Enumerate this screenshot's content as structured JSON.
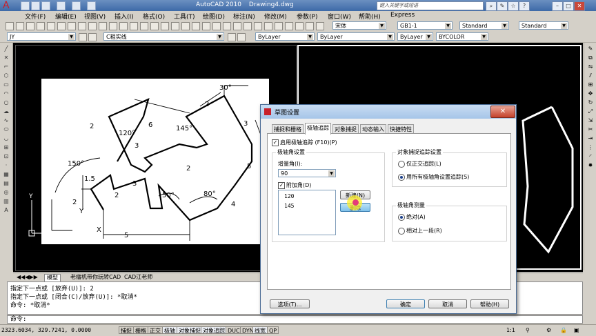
{
  "app": {
    "title_app": "AutoCAD 2010",
    "title_doc": "Drawing4.dwg",
    "search_placeholder": "键入关键字或短语",
    "logo_glyph": "A"
  },
  "menu": [
    "文件(F)",
    "编辑(E)",
    "视图(V)",
    "插入(I)",
    "格式(O)",
    "工具(T)",
    "绘图(D)",
    "标注(N)",
    "修改(M)",
    "参数(P)",
    "窗口(W)",
    "帮助(H)",
    "Express"
  ],
  "toolbar2": {
    "font": "宋体",
    "dimstyle": "GB1-1",
    "textstyle": "Standard",
    "tablestyle": "Standard"
  },
  "toolbar3": {
    "workspace": "JY",
    "layer": "C粗实线",
    "color": "ByLayer",
    "linetype": "ByLayer",
    "lineweight": "ByLayer",
    "plotstyle": "BYCOLOR"
  },
  "drawing": {
    "dims": [
      "30°",
      "2",
      "145°",
      "3",
      "6",
      "120°",
      "3",
      "2",
      "150°",
      "1.5",
      "2",
      "2",
      "5",
      "3",
      "80°",
      "50°",
      "4",
      "2",
      "5"
    ],
    "axis_y": "Y",
    "axis_x": "X"
  },
  "layout_tabs": [
    "模型",
    "老瘤机带你玩转CAD",
    "CAD江老师"
  ],
  "command_history": [
    "指定下一点或 [放弃(U)]: 2",
    "指定下一点或 [闭合(C)/放弃(U)]: *取消*",
    "命令: *取消*"
  ],
  "command_prompt": "命令:",
  "status": {
    "coords": "2323.6034, 329.7241, 0.0000",
    "buttons": [
      "捕捉",
      "栅格",
      "正交",
      "极轴",
      "对象捕捉",
      "对象追踪",
      "DUCS",
      "DYN",
      "线宽",
      "QP"
    ],
    "scale": "1:1"
  },
  "dialog": {
    "title": "草图设置",
    "tabs": [
      "捕捉和栅格",
      "极轴追踪",
      "对象捕捉",
      "动态输入",
      "快捷特性"
    ],
    "active_tab": 1,
    "enable_polar": "启用极轴追踪 (F10)(P)",
    "polar_group": "极轴角设置",
    "increment_label": "增量角(I):",
    "increment_value": "90",
    "additional_label": "附加角(D)",
    "additional_angles": [
      "120",
      "145"
    ],
    "new_button": "新建(N)",
    "delete_button": "删除",
    "osnap_group": "对象捕捉追踪设置",
    "osnap_opt1": "仅正交追踪(L)",
    "osnap_opt2": "用所有极轴角设置追踪(S)",
    "measure_group": "极轴角测量",
    "measure_opt1": "绝对(A)",
    "measure_opt2": "相对上一段(R)",
    "options_button": "选项(T)...",
    "ok_button": "确定",
    "cancel_button": "取消",
    "help_button": "帮助(H)"
  }
}
